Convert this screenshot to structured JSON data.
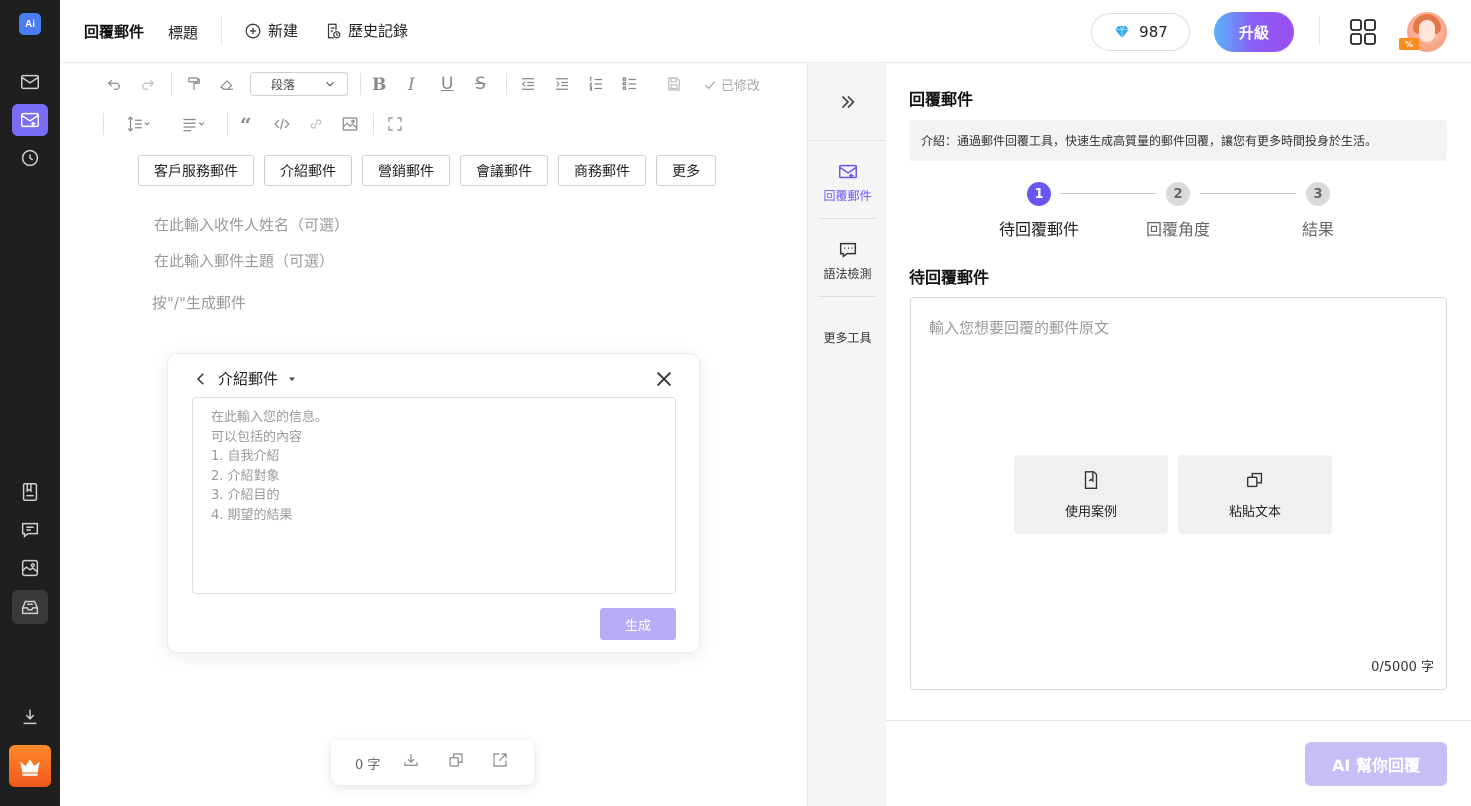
{
  "app": {
    "logo_text": "Ai",
    "title": "回覆郵件",
    "title_tab": "標題",
    "new_label": "新建",
    "history_label": "歷史記錄",
    "gems": "987",
    "upgrade_label": "升級",
    "avatar_badge": "%"
  },
  "editor": {
    "paragraph_select": "段落",
    "modified_label": "已修改",
    "chips": [
      "客戶服務郵件",
      "介紹郵件",
      "營銷郵件",
      "會議郵件",
      "商務郵件",
      "更多"
    ],
    "recipient_placeholder": "在此輸入收件人姓名（可選）",
    "subject_placeholder": "在此輸入郵件主題（可選）",
    "slash_hint": "按\"/\"生成郵件",
    "word_count": "0 字"
  },
  "popup": {
    "title": "介紹郵件",
    "placeholder_lines": [
      "在此輸入您的信息。",
      "可以包括的內容",
      "1. 自我介紹",
      "2. 介紹對象",
      "3. 介紹目的",
      "4. 期望的結果"
    ],
    "generate_label": "生成"
  },
  "tools": {
    "reply": "回覆郵件",
    "grammar": "語法檢測",
    "more": "更多工具"
  },
  "panel": {
    "title": "回覆郵件",
    "intro": "介紹：通過郵件回覆工具，快速生成高質量的郵件回覆，讓您有更多時間投身於生活。",
    "steps": [
      {
        "num": "1",
        "label": "待回覆郵件"
      },
      {
        "num": "2",
        "label": "回覆角度"
      },
      {
        "num": "3",
        "label": "結果"
      }
    ],
    "section_title": "待回覆郵件",
    "input_placeholder": "輸入您想要回覆的郵件原文",
    "use_example": "使用案例",
    "paste_text": "粘貼文本",
    "char_count": "0/5000 字",
    "ai_button": "AI 幫你回覆"
  },
  "colors": {
    "accent": "#6a56f2",
    "rail_bg": "#1f1f1f",
    "generate_disabled": "#b8acf6",
    "ai_button_disabled": "#c9bdf8"
  }
}
